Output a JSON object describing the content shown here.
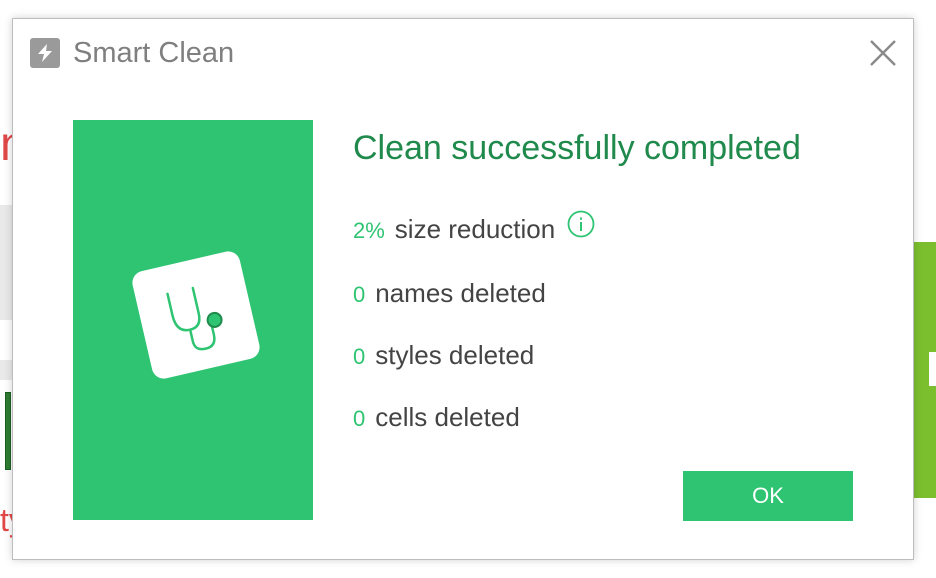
{
  "background": {
    "red_fragment": "n",
    "red_text_fragment": "ty"
  },
  "dialog": {
    "title": "Smart Clean",
    "app_icon": "lightning-icon",
    "close_icon": "close-icon",
    "heading": "Clean successfully completed",
    "hero_icon": "stethoscope-icon",
    "stats": [
      {
        "value": "2%",
        "label": "size reduction",
        "has_info": true
      },
      {
        "value": "0",
        "label": "names deleted"
      },
      {
        "value": "0",
        "label": "styles deleted"
      },
      {
        "value": "0",
        "label": "cells deleted"
      }
    ],
    "ok_label": "OK"
  },
  "colors": {
    "accent": "#2ec472",
    "heading": "#1f8a4c",
    "title": "#7f7f7f",
    "text": "#444444"
  }
}
